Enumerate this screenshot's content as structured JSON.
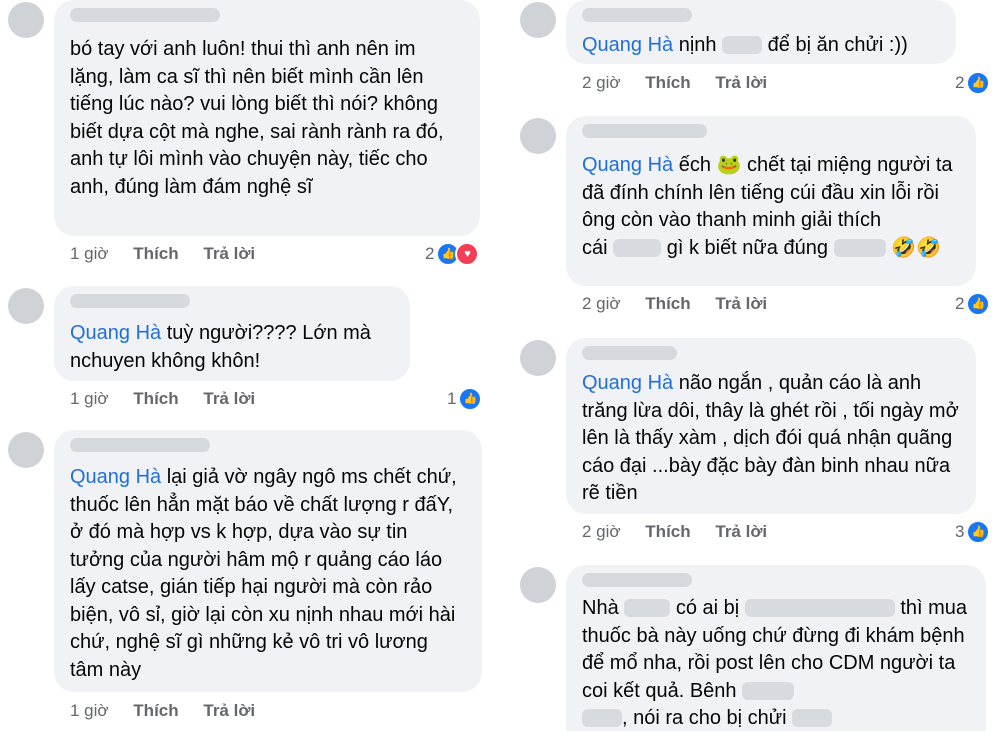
{
  "comments": [
    {
      "text": "bó tay với anh luôn! thui thì anh nên im lặng, làm ca sĩ thì nên biết mình cần lên tiếng lúc nào? vui lòng biết thì nói? không biết dựa cột mà nghe, sai rành rành ra đó, anh tự lôi mình vào chuyện này, tiếc cho anh, đúng làm đám nghệ sĩ",
      "time": "1 giờ",
      "like": "Thích",
      "reply": "Trả lời",
      "reactions": "2",
      "reaction_icons": [
        "like-icon",
        "love-icon"
      ]
    },
    {
      "mention": "Quang Hà",
      "text": "tuỳ người???? Lớn mà nchuyen không khôn!",
      "time": "1 giờ",
      "like": "Thích",
      "reply": "Trả lời",
      "reactions": "1",
      "reaction_icons": [
        "like-icon"
      ]
    },
    {
      "mention": "Quang Hà",
      "text": "lại giả vờ ngây ngô ms chết chứ, thuốc lên hẳn mặt báo về chất lượng r đấY, ở đó mà hợp vs k hợp, dựa vào sự tin tưởng của người hâm mộ r quảng cáo láo lấy catse, gián tiếp hại người mà còn rảo biện, vô sỉ, giờ lại còn xu nịnh nhau mới hài chứ, nghệ sĩ gì những kẻ vô tri vô lương tâm này",
      "time": "1 giờ",
      "like": "Thích",
      "reply": "Trả lời"
    },
    {
      "mention": "Quang Hà",
      "text_a": "nịnh",
      "text_b": "để bị ăn chửi :))",
      "time": "2 giờ",
      "like": "Thích",
      "reply": "Trả lời",
      "reactions": "2",
      "reaction_icons": [
        "like-icon"
      ]
    },
    {
      "mention": "Quang Hà",
      "text_a": "ếch",
      "text_b": "chết tại miệng người ta đã đính chính lên tiếng cúi đầu xin lỗi rồi ông còn vào thanh minh giải thích",
      "text_c": "cái",
      "text_d": "gì k biết nữa đúng",
      "emoji_frog": "🐸",
      "emoji_laugh": "🤣🤣",
      "time": "2 giờ",
      "like": "Thích",
      "reply": "Trả lời",
      "reactions": "2",
      "reaction_icons": [
        "like-icon"
      ]
    },
    {
      "mention": "Quang Hà",
      "text": "não ngắn , quản cáo là anh trăng lừa dôi, thây là ghét rồi , tối ngày mở lên là thấy xàm , dịch đói quá nhận quãng cáo đại ...bày đặc bày đàn binh nhau nữa rẽ tiền",
      "time": "2 giờ",
      "like": "Thích",
      "reply": "Trả lời",
      "reactions": "3",
      "reaction_icons": [
        "like-icon"
      ]
    },
    {
      "text_a": "Nhà",
      "text_b": "có ai bị",
      "text_c": "thì",
      "text_d": "mua thuốc bà này uống chứ đừng đi khám bệnh để mổ nha, rồi post lên cho CDM người ta coi kết quả. Bênh",
      "text_e": ", nói ra cho bị chửi"
    }
  ]
}
